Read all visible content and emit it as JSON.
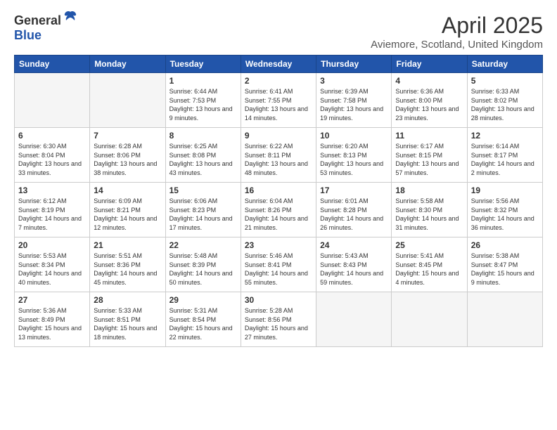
{
  "logo": {
    "general": "General",
    "blue": "Blue"
  },
  "title": "April 2025",
  "subtitle": "Aviemore, Scotland, United Kingdom",
  "days_of_week": [
    "Sunday",
    "Monday",
    "Tuesday",
    "Wednesday",
    "Thursday",
    "Friday",
    "Saturday"
  ],
  "weeks": [
    [
      {
        "day": "",
        "empty": true
      },
      {
        "day": "",
        "empty": true
      },
      {
        "day": "1",
        "sunrise": "6:44 AM",
        "sunset": "7:53 PM",
        "daylight": "13 hours and 9 minutes."
      },
      {
        "day": "2",
        "sunrise": "6:41 AM",
        "sunset": "7:55 PM",
        "daylight": "13 hours and 14 minutes."
      },
      {
        "day": "3",
        "sunrise": "6:39 AM",
        "sunset": "7:58 PM",
        "daylight": "13 hours and 19 minutes."
      },
      {
        "day": "4",
        "sunrise": "6:36 AM",
        "sunset": "8:00 PM",
        "daylight": "13 hours and 23 minutes."
      },
      {
        "day": "5",
        "sunrise": "6:33 AM",
        "sunset": "8:02 PM",
        "daylight": "13 hours and 28 minutes."
      }
    ],
    [
      {
        "day": "6",
        "sunrise": "6:30 AM",
        "sunset": "8:04 PM",
        "daylight": "13 hours and 33 minutes."
      },
      {
        "day": "7",
        "sunrise": "6:28 AM",
        "sunset": "8:06 PM",
        "daylight": "13 hours and 38 minutes."
      },
      {
        "day": "8",
        "sunrise": "6:25 AM",
        "sunset": "8:08 PM",
        "daylight": "13 hours and 43 minutes."
      },
      {
        "day": "9",
        "sunrise": "6:22 AM",
        "sunset": "8:11 PM",
        "daylight": "13 hours and 48 minutes."
      },
      {
        "day": "10",
        "sunrise": "6:20 AM",
        "sunset": "8:13 PM",
        "daylight": "13 hours and 53 minutes."
      },
      {
        "day": "11",
        "sunrise": "6:17 AM",
        "sunset": "8:15 PM",
        "daylight": "13 hours and 57 minutes."
      },
      {
        "day": "12",
        "sunrise": "6:14 AM",
        "sunset": "8:17 PM",
        "daylight": "14 hours and 2 minutes."
      }
    ],
    [
      {
        "day": "13",
        "sunrise": "6:12 AM",
        "sunset": "8:19 PM",
        "daylight": "14 hours and 7 minutes."
      },
      {
        "day": "14",
        "sunrise": "6:09 AM",
        "sunset": "8:21 PM",
        "daylight": "14 hours and 12 minutes."
      },
      {
        "day": "15",
        "sunrise": "6:06 AM",
        "sunset": "8:23 PM",
        "daylight": "14 hours and 17 minutes."
      },
      {
        "day": "16",
        "sunrise": "6:04 AM",
        "sunset": "8:26 PM",
        "daylight": "14 hours and 21 minutes."
      },
      {
        "day": "17",
        "sunrise": "6:01 AM",
        "sunset": "8:28 PM",
        "daylight": "14 hours and 26 minutes."
      },
      {
        "day": "18",
        "sunrise": "5:58 AM",
        "sunset": "8:30 PM",
        "daylight": "14 hours and 31 minutes."
      },
      {
        "day": "19",
        "sunrise": "5:56 AM",
        "sunset": "8:32 PM",
        "daylight": "14 hours and 36 minutes."
      }
    ],
    [
      {
        "day": "20",
        "sunrise": "5:53 AM",
        "sunset": "8:34 PM",
        "daylight": "14 hours and 40 minutes."
      },
      {
        "day": "21",
        "sunrise": "5:51 AM",
        "sunset": "8:36 PM",
        "daylight": "14 hours and 45 minutes."
      },
      {
        "day": "22",
        "sunrise": "5:48 AM",
        "sunset": "8:39 PM",
        "daylight": "14 hours and 50 minutes."
      },
      {
        "day": "23",
        "sunrise": "5:46 AM",
        "sunset": "8:41 PM",
        "daylight": "14 hours and 55 minutes."
      },
      {
        "day": "24",
        "sunrise": "5:43 AM",
        "sunset": "8:43 PM",
        "daylight": "14 hours and 59 minutes."
      },
      {
        "day": "25",
        "sunrise": "5:41 AM",
        "sunset": "8:45 PM",
        "daylight": "15 hours and 4 minutes."
      },
      {
        "day": "26",
        "sunrise": "5:38 AM",
        "sunset": "8:47 PM",
        "daylight": "15 hours and 9 minutes."
      }
    ],
    [
      {
        "day": "27",
        "sunrise": "5:36 AM",
        "sunset": "8:49 PM",
        "daylight": "15 hours and 13 minutes."
      },
      {
        "day": "28",
        "sunrise": "5:33 AM",
        "sunset": "8:51 PM",
        "daylight": "15 hours and 18 minutes."
      },
      {
        "day": "29",
        "sunrise": "5:31 AM",
        "sunset": "8:54 PM",
        "daylight": "15 hours and 22 minutes."
      },
      {
        "day": "30",
        "sunrise": "5:28 AM",
        "sunset": "8:56 PM",
        "daylight": "15 hours and 27 minutes."
      },
      {
        "day": "",
        "empty": true
      },
      {
        "day": "",
        "empty": true
      },
      {
        "day": "",
        "empty": true
      }
    ]
  ]
}
